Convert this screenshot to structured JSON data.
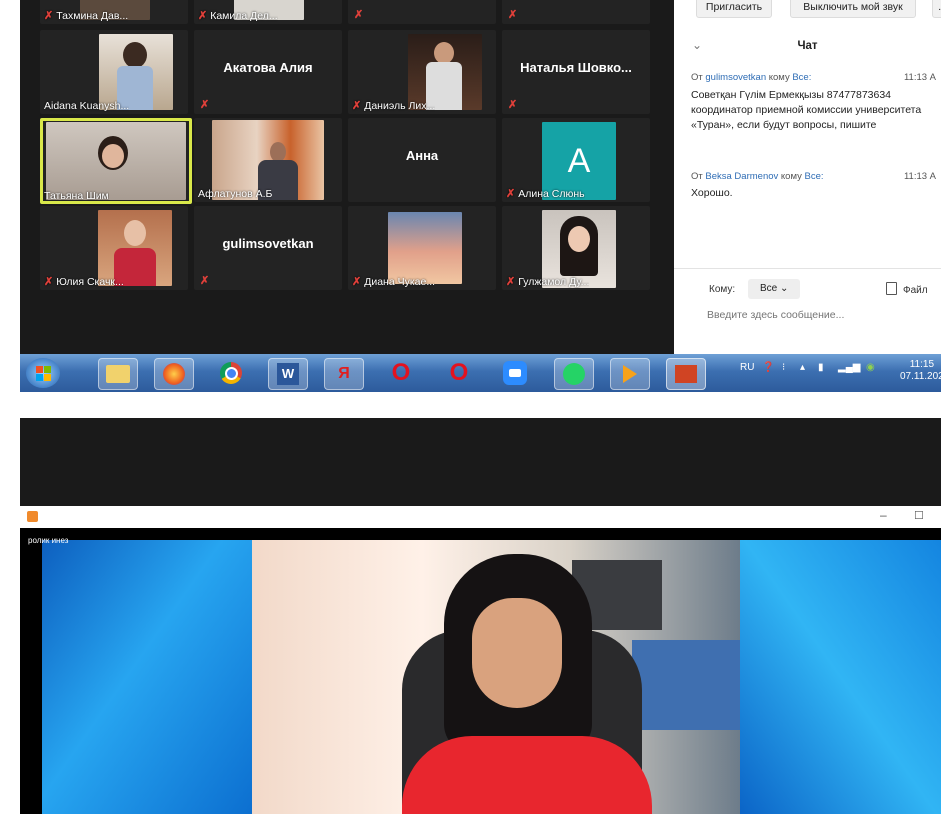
{
  "grid": {
    "tiles": [
      {
        "name": "Тахмина Дав...",
        "muted": true
      },
      {
        "name": "Камила Дел...",
        "muted": true
      },
      {
        "name": "",
        "muted": true
      },
      {
        "name": "",
        "muted": true
      },
      {
        "name": "Aidana Kuanysh...",
        "muted": false
      },
      {
        "name": "",
        "muted": true,
        "center_name": "Акатова Алия"
      },
      {
        "name": "Даниэль Лих...",
        "muted": true
      },
      {
        "name": "",
        "muted": true,
        "center_name": "Наталья  Шовко..."
      },
      {
        "name": "Татьяна Шим",
        "muted": false,
        "active": true
      },
      {
        "name": "Афлатунов А.Б",
        "muted": false
      },
      {
        "name": "",
        "muted": false,
        "center_name": "Анна"
      },
      {
        "name": "Алина Слюнь",
        "muted": true,
        "avatar_letter": "A"
      },
      {
        "name": "Юлия Скачк...",
        "muted": true
      },
      {
        "name": "",
        "muted": true,
        "center_name": "gulimsovetkan"
      },
      {
        "name": "Диана Чукае...",
        "muted": true
      },
      {
        "name": "Гулжамол Ду...",
        "muted": true
      }
    ]
  },
  "chat": {
    "invite_button": "Пригласить",
    "mute_button": "Выключить мой звук",
    "title": "Чат",
    "messages": [
      {
        "prefix": "От",
        "sender": "gulimsovetkan",
        "to_word": "кому",
        "to": "Все:",
        "time": "11:13 А",
        "text": "Советқан Гүлім Ермекқызы 87477873634 координатор приемной комиссии университета «Туран», если будут вопросы, пишите"
      },
      {
        "prefix": "От",
        "sender": "Beksa Darmenov",
        "to_word": "кому",
        "to": "Все:",
        "time": "11:13 А",
        "text": "Хорошо."
      }
    ],
    "to_label": "Кому:",
    "to_value": "Все",
    "file_label": "Файл",
    "input_placeholder": "Введите здесь сообщение..."
  },
  "taskbar": {
    "lang": "RU",
    "time": "11:15",
    "date": "07.11.202"
  },
  "bottom": {
    "window_label": "ролик инез"
  },
  "colors": {
    "active_border": "#d9e84a",
    "avatar_teal": "#15a3a6",
    "link_blue": "#2f6db5"
  }
}
